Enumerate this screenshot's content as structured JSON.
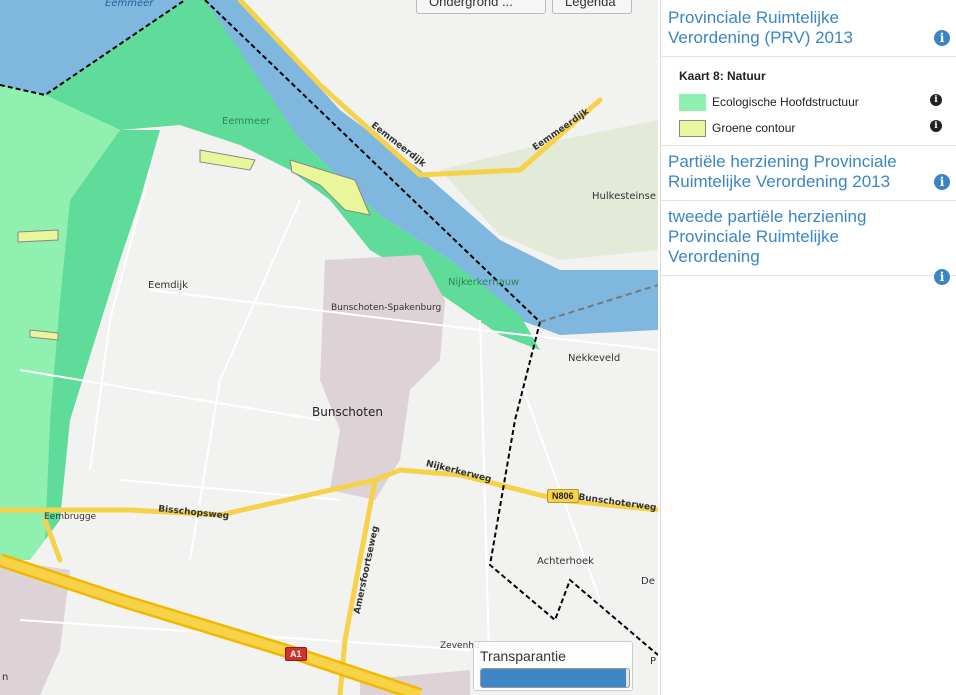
{
  "map": {
    "buttons": {
      "ondergrond": "Ondergrond ...",
      "legenda": "Legenda"
    },
    "labels": {
      "eemmeer_top": "Eemmeer",
      "eemmeer_nat": "Eemmeer",
      "eemmeerdijk1": "Eemmeerdijk",
      "eemmeerdijk2": "Eemmeerdijk",
      "hulkesteinse": "Hulkesteinse",
      "eemdijk": "Eemdijk",
      "nijkerkernauw": "Nijkerkernauw",
      "spakenburg": "Bunschoten-Spakenburg",
      "nekkeveld": "Nekkeveld",
      "bunschoten": "Bunschoten",
      "nijkerkerweg": "Nijkerkerweg",
      "bunschoterweg": "Bunschoterweg",
      "bisschopsweg": "Bisschopsweg",
      "eembrugge": "Eembrugge",
      "amersfoortseweg": "Amersfoortseweg",
      "achterhoek": "Achterhoek",
      "de": "De",
      "zevenhu": "Zevenhu",
      "p": "P",
      "n_left": "n"
    },
    "shields": {
      "n806": "N806",
      "a1": "A1"
    },
    "transparantie": {
      "label": "Transparantie",
      "value": 0.98
    },
    "colors": {
      "water": "#7fb7df",
      "ehs": "#5fdc9a",
      "groene": "#e9f69a",
      "urban": "#ddd3d6",
      "boundary": "#000000"
    }
  },
  "sidebar": {
    "sections": [
      {
        "title": "Provinciale Ruimtelijke Verordening (PRV) 2013"
      },
      {
        "title": "Partiële herziening Provinciale Ruimtelijke Verordening 2013"
      },
      {
        "title": "tweede partiële herziening Provinciale Ruimtelijke Verordening"
      }
    ],
    "legend": {
      "title": "Kaart 8: Natuur",
      "items": [
        {
          "label": "Ecologische Hoofdstructuur",
          "color": "#8ff0b0"
        },
        {
          "label": "Groene contour",
          "color": "#e6f7a0"
        }
      ]
    },
    "info_glyph": "i"
  }
}
